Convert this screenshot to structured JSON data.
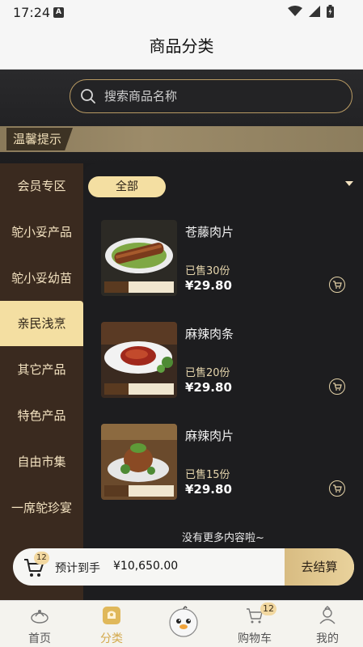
{
  "status": {
    "time": "17:24",
    "a_icon": "A"
  },
  "header": {
    "title": "商品分类"
  },
  "search": {
    "placeholder": "搜索商品名称"
  },
  "tip": {
    "label": "温馨提示"
  },
  "sidebar": {
    "items": [
      {
        "label": "会员专区"
      },
      {
        "label": "鸵小妥产品"
      },
      {
        "label": "鸵小妥幼苗"
      },
      {
        "label": "亲民浅烹"
      },
      {
        "label": "其它产品"
      },
      {
        "label": "特色产品"
      },
      {
        "label": "自由市集"
      },
      {
        "label": "一席鸵珍宴"
      }
    ],
    "active_index": 3
  },
  "filter": {
    "label": "全部"
  },
  "products": [
    {
      "name": "苍藤肉片",
      "sold": "已售30份",
      "price": "¥29.80",
      "icon": "cart-icon"
    },
    {
      "name": "麻辣肉条",
      "sold": "已售20份",
      "price": "¥29.80",
      "icon": "cart-icon"
    },
    {
      "name": "麻辣肉片",
      "sold": "已售15份",
      "price": "¥29.80",
      "icon": "cart-icon"
    }
  ],
  "list_end": {
    "text": "没有更多内容啦~"
  },
  "cart_bar": {
    "badge": "12",
    "total_label": "预计到手",
    "total_amount": "¥10,650.00",
    "checkout_label": "去结算"
  },
  "tabs": [
    {
      "label": "首页",
      "icon": "home-icon"
    },
    {
      "label": "分类",
      "icon": "category-icon",
      "active": true
    },
    {
      "label": "",
      "icon": "mascot-icon"
    },
    {
      "label": "购物车",
      "icon": "cart-icon",
      "badge": "12"
    },
    {
      "label": "我的",
      "icon": "profile-icon"
    }
  ],
  "colors": {
    "accent_gold": "#f4dfa2",
    "sidebar_bg": "#3a2a1f",
    "dark_bg": "#1d1d1f",
    "tab_active": "#d3a94c"
  }
}
